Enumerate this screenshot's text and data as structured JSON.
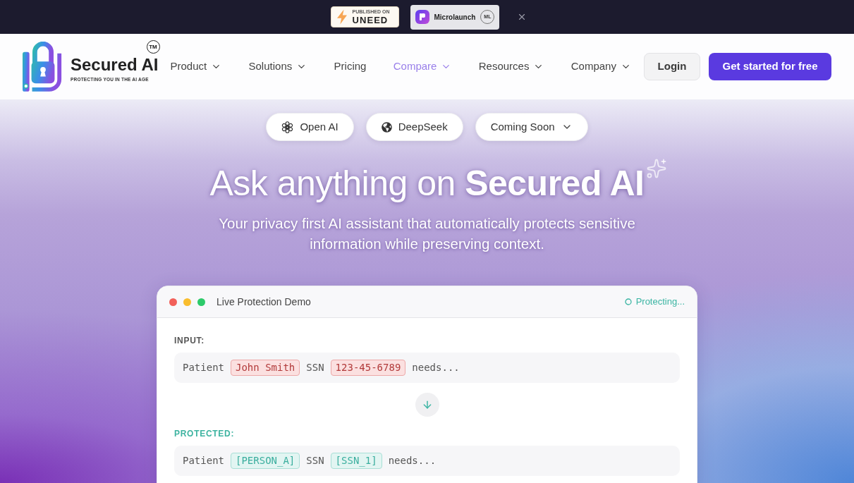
{
  "banner": {
    "badges": [
      {
        "kind": "uneed",
        "caption": "PUBLISHED ON",
        "name": "UNEED"
      },
      {
        "kind": "microlaunch",
        "name": "Microlaunch",
        "emblem": "ML"
      }
    ]
  },
  "header": {
    "logo": {
      "name": "Secured AI",
      "trademark": "TM",
      "tagline": "PROTECTING YOU IN THE AI AGE"
    },
    "nav": [
      {
        "label": "Product",
        "dropdown": true,
        "selected": false
      },
      {
        "label": "Solutions",
        "dropdown": true,
        "selected": false
      },
      {
        "label": "Pricing",
        "dropdown": false,
        "selected": false
      },
      {
        "label": "Compare",
        "dropdown": true,
        "selected": true
      },
      {
        "label": "Resources",
        "dropdown": true,
        "selected": false
      },
      {
        "label": "Company",
        "dropdown": true,
        "selected": false
      }
    ],
    "login": "Login",
    "cta": "Get started for free"
  },
  "hero": {
    "models": [
      {
        "label": "Open AI",
        "kind": "openai"
      },
      {
        "label": "DeepSeek",
        "kind": "globe"
      },
      {
        "label": "Coming Soon",
        "kind": "menu"
      }
    ],
    "title": "Ask anything on **Secured AI**",
    "subtitle": "Your privacy first AI assistant that automatically protects sensitive information while preserving context."
  },
  "demo": {
    "title": "Live Protection Demo",
    "status": "Protecting...",
    "sections": [
      {
        "label": "INPUT:",
        "kind": "input",
        "segments": [
          {
            "text": "Patient",
            "kind": "plain"
          },
          {
            "text": "John Smith",
            "kind": "sensitive"
          },
          {
            "text": "SSN",
            "kind": "plain"
          },
          {
            "text": "123-45-6789",
            "kind": "sensitive"
          },
          {
            "text": "needs...",
            "kind": "plain"
          }
        ]
      },
      {
        "label": "PROTECTED:",
        "kind": "protected",
        "segments": [
          {
            "text": "Patient",
            "kind": "plain"
          },
          {
            "text": "[PERSON_A]",
            "kind": "token"
          },
          {
            "text": "SSN",
            "kind": "plain"
          },
          {
            "text": "[SSN_1]",
            "kind": "token"
          },
          {
            "text": "needs...",
            "kind": "plain"
          }
        ]
      }
    ]
  }
}
